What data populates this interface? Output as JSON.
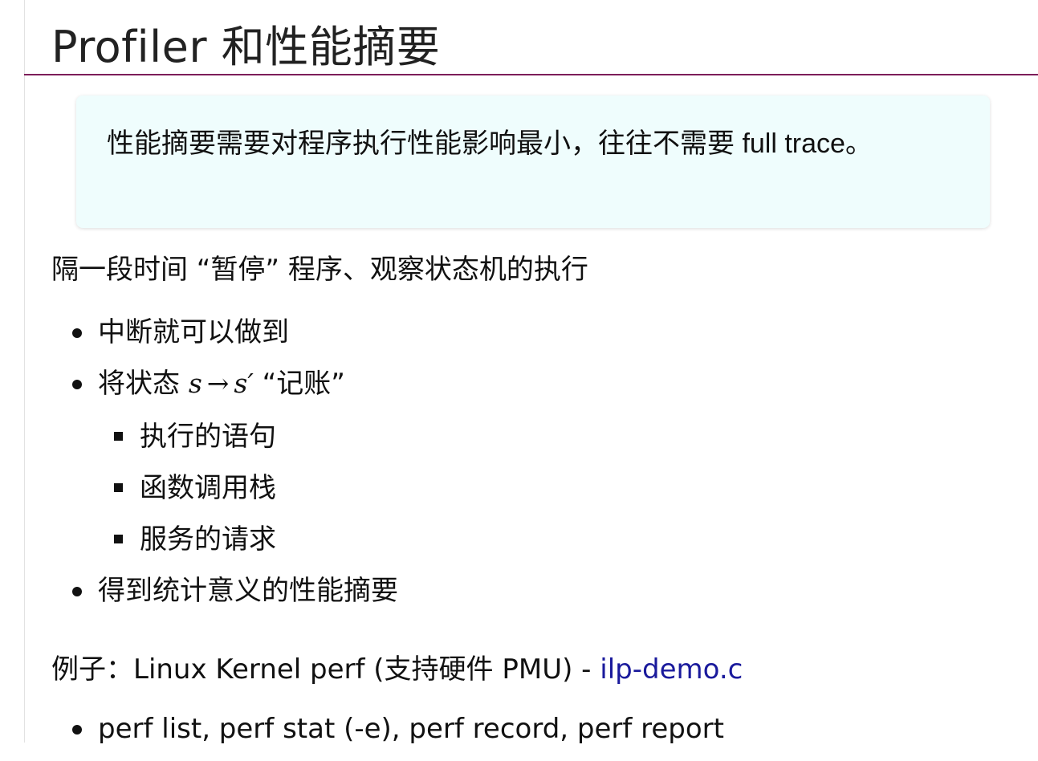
{
  "title": "Profiler 和性能摘要",
  "callout": {
    "text_cjk": "性能摘要需要对程序执行性能影响最小，往往不需要",
    "text_latin": " full trace",
    "text_end": "。"
  },
  "intro": "隔一段时间 “暂停” 程序、观察状态机的执行",
  "bullets": {
    "item1": "中断就可以做到",
    "item2_prefix": "将状态 ",
    "item2_s": "s",
    "item2_arrow": "→",
    "item2_sprime": "s′",
    "item2_suffix": " “记账”",
    "sub": [
      "执行的语句",
      "函数调用栈",
      "服务的请求"
    ],
    "item3": "得到统计意义的性能摘要"
  },
  "example": {
    "prefix": "例子：Linux Kernel perf (支持硬件 PMU) - ",
    "link": "ilp-demo.c"
  },
  "commands": "perf list, perf stat (-e), perf record, perf report"
}
